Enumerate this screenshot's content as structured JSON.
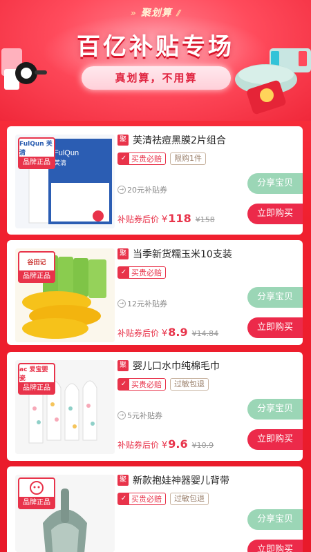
{
  "banner": {
    "brand": "聚划算",
    "title": "百亿补贴专场",
    "slogan": "真划算，不用算"
  },
  "products": [
    {
      "brand_logo": "FulQun 芙清",
      "brand_badge": "品牌正品",
      "ju_icon": "聚",
      "title": "芙清祛痘黑膜2片组合",
      "tag_primary": "买贵必赔",
      "tag_secondary": "限购1件",
      "coupon": "20元补贴券",
      "price_label": "补贴券后价",
      "currency": "¥",
      "price": "118",
      "original_price": "¥158",
      "share_label": "分享宝贝",
      "buy_label": "立即购买"
    },
    {
      "brand_logo": "谷田记",
      "brand_badge": "品牌正品",
      "ju_icon": "聚",
      "title": "当季新货糯玉米10支装",
      "tag_primary": "买贵必赔",
      "tag_secondary": "",
      "coupon": "12元补贴券",
      "price_label": "补贴券后价",
      "currency": "¥",
      "price": "8.9",
      "original_price": "¥14.84",
      "share_label": "分享宝贝",
      "buy_label": "立即购买"
    },
    {
      "brand_logo": "ac 爱宝婴瓷",
      "brand_badge": "品牌正品",
      "ju_icon": "聚",
      "title": "婴儿口水巾纯棉毛巾",
      "tag_primary": "买贵必赔",
      "tag_secondary": "过敏包退",
      "coupon": "5元补贴券",
      "price_label": "补贴券后价",
      "currency": "¥",
      "price": "9.6",
      "original_price": "¥10.9",
      "share_label": "分享宝贝",
      "buy_label": "立即购买"
    },
    {
      "brand_logo": "",
      "brand_badge": "品牌正品",
      "ju_icon": "聚",
      "title": "新款抱娃神器婴儿背带",
      "tag_primary": "买贵必赔",
      "tag_secondary": "过敏包退",
      "coupon": "",
      "price_label": "",
      "currency": "",
      "price": "",
      "original_price": "",
      "share_label": "分享宝贝",
      "buy_label": "立即购买"
    }
  ],
  "colors": {
    "primary_red": "#e8334a",
    "share_green": "#9bd6b6",
    "buy_red": "#ec2a4a",
    "background_red": "#f0202f"
  },
  "icons": {
    "ju": "ju-icon",
    "guarantee": "shield-icon",
    "coupon": "arrow-circle-icon"
  }
}
